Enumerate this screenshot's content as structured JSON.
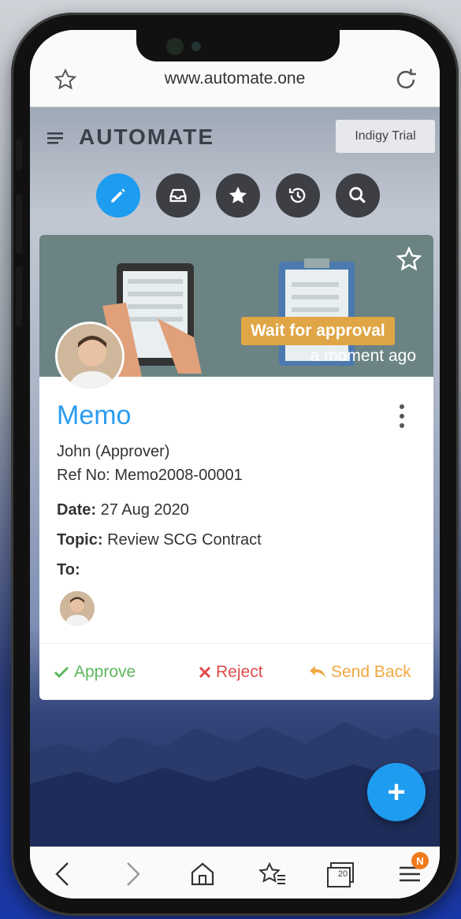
{
  "browser": {
    "url": "www.automate.one"
  },
  "app": {
    "brand": "AUTOMATE",
    "trial_badge": "Indigy Trial",
    "toolbar": [
      "pencil-icon",
      "inbox-icon",
      "star-icon",
      "history-icon",
      "search-icon"
    ]
  },
  "card": {
    "status": "Wait for approval",
    "timestamp": "a moment ago",
    "title": "Memo",
    "approver": "John (Approver)",
    "ref": "Ref No: Memo2008-00001",
    "date_label": "Date:",
    "date_value": "27 Aug 2020",
    "topic_label": "Topic:",
    "topic_value": "Review SCG Contract",
    "to_label": "To:",
    "actions": {
      "approve": "Approve",
      "reject": "Reject",
      "send_back": "Send Back"
    }
  },
  "fab": {
    "label": "+"
  },
  "bottom_nav": {
    "tabs_count": "20",
    "notification_badge": "N"
  },
  "colors": {
    "accent": "#1e9cf0",
    "approve": "#5cb85c",
    "reject": "#e04b4b",
    "send_back": "#f0a840",
    "status_badge": "#e0a545"
  }
}
